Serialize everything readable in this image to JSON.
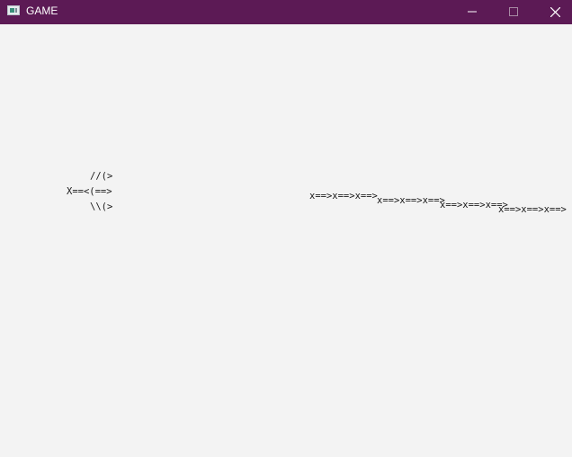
{
  "window": {
    "title": "GAME",
    "titlebar_color": "#5c1a55",
    "background_color": "#f3f3f3",
    "icons": [
      "app-icon",
      "minimize-icon",
      "maximize-icon",
      "close-icon"
    ]
  },
  "player": {
    "lines": [
      "//(>",
      "X==<(==>",
      "\\\\(>"
    ]
  },
  "enemies": [
    {
      "text": "x==>x==>x==>"
    },
    {
      "text": "x==>x==>x==>"
    },
    {
      "text": "x==>x==>x==>"
    },
    {
      "text": "x==>x==>x==>"
    }
  ]
}
